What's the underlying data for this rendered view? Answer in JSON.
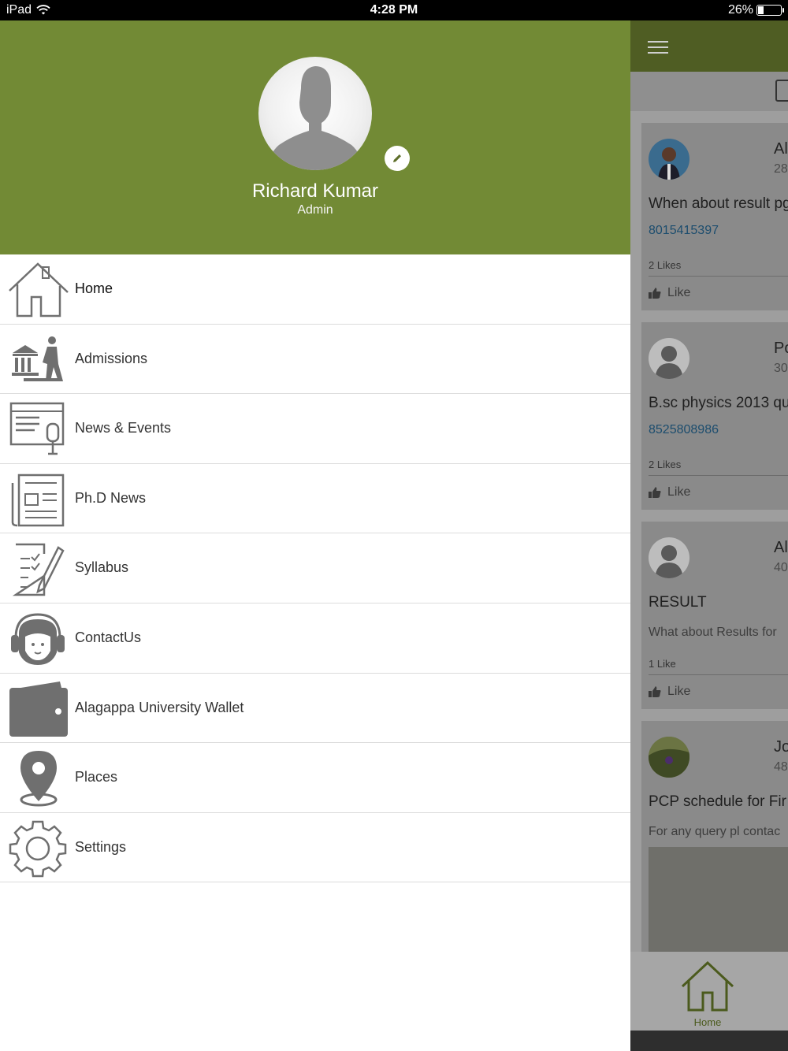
{
  "status_bar": {
    "device": "iPad",
    "time": "4:28 PM",
    "battery": "26%",
    "battery_level": 0.26
  },
  "drawer": {
    "user": {
      "name": "Richard Kumar",
      "role": "Admin"
    },
    "menu": [
      {
        "label": "Home",
        "icon": "home-icon"
      },
      {
        "label": "Admissions",
        "icon": "admissions-icon"
      },
      {
        "label": "News & Events",
        "icon": "news-events-icon"
      },
      {
        "label": "Ph.D News",
        "icon": "newspaper-icon"
      },
      {
        "label": "Syllabus",
        "icon": "syllabus-icon"
      },
      {
        "label": "ContactUs",
        "icon": "headset-agent-icon"
      },
      {
        "label": "Alagappa University Wallet",
        "icon": "wallet-icon"
      },
      {
        "label": "Places",
        "icon": "map-pin-icon"
      },
      {
        "label": "Settings",
        "icon": "gear-icon"
      }
    ]
  },
  "feed": {
    "posts": [
      {
        "name": "Al",
        "date": "28",
        "title": "When about result pg",
        "phone": "8015415397",
        "likes": "2 Likes",
        "like_label": "Like"
      },
      {
        "name": "Po",
        "date": "30",
        "title": "B.sc physics 2013 qu",
        "phone": "8525808986",
        "likes": "2 Likes",
        "like_label": "Like"
      },
      {
        "name": "Al",
        "date": "40",
        "title": "RESULT",
        "desc": "What about Results for",
        "likes": "1 Like",
        "like_label": "Like"
      },
      {
        "name": "Jo",
        "date": "48",
        "title": "PCP schedule for Fir",
        "desc": "For any query pl contac"
      }
    ],
    "tab_home_label": "Home"
  },
  "colors": {
    "drawer_header": "#728a35",
    "appbar": "#4f5d23",
    "icon_gray": "#6f6f6f"
  }
}
